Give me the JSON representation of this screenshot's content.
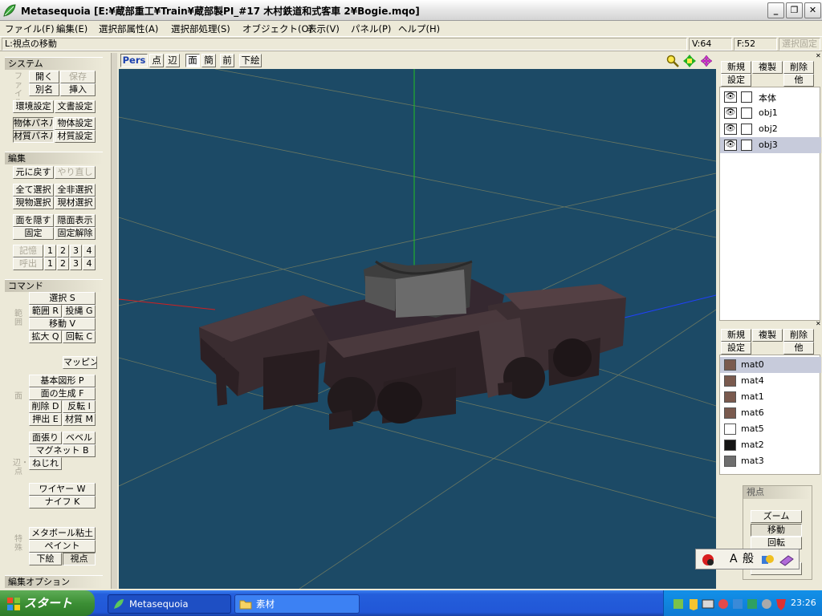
{
  "window": {
    "title": "Metasequoia [E:¥蔵部重工¥Train¥蔵部製PI_#17 木村鉄道和式客車 2¥Bogie.mqo]"
  },
  "menu": [
    "ファイル(F)",
    "編集(E)",
    "選択部属性(A)",
    "選択部処理(S)",
    "オブジェクト(O)",
    "表示(V)",
    "パネル(P)",
    "ヘルプ(H)"
  ],
  "status": {
    "hint": "L:視点の移動",
    "vertices": "V:64",
    "faces": "F:52",
    "lock": "選択固定"
  },
  "left": {
    "system": {
      "header": "システム",
      "file_label": "ファイル",
      "open": "開く",
      "save": "保存",
      "rename": "別名",
      "insert": "挿入",
      "env": "環境設定",
      "doc": "文書設定",
      "obj_panel": "物体パネル",
      "obj_settings": "物体設定",
      "mat_panel": "材質パネル",
      "mat_settings": "材質設定"
    },
    "edit": {
      "header": "編集",
      "undo": "元に戻す",
      "redo": "やり直し",
      "select_all": "全て選択",
      "deselect": "全非選択",
      "cur_obj": "現物選択",
      "cur_mat": "現材選択",
      "hide_face": "面を隠す",
      "show_face": "隠面表示",
      "fix": "固定",
      "unfix": "固定解除",
      "memory": "記憶",
      "recall": "呼出",
      "slots": [
        "1",
        "2",
        "3",
        "4"
      ]
    },
    "command": {
      "header": "コマンド",
      "range_label": "範囲",
      "select": "選択 S",
      "range": "範囲 R",
      "lasso": "投縄 G",
      "move": "移動 V",
      "scale": "拡大 Q",
      "rotate": "回転 C",
      "mapping": "マッピング",
      "face_label": "面",
      "primitive": "基本図形 P",
      "create_face": "面の生成 F",
      "delete": "削除 D",
      "flip": "反転 I",
      "extrude": "押出 E",
      "material": "材質 M",
      "edge_label": "辺・点",
      "face_fill": "面張り",
      "bevel": "ベベル",
      "magnet": "マグネット B",
      "twist": "ねじれ",
      "wire": "ワイヤー W",
      "knife": "ナイフ K",
      "special_label": "特殊",
      "metaball": "メタボール粘土",
      "paint": "ペイント",
      "underlay": "下絵",
      "view": "視点"
    },
    "edit_options": "編集オプション"
  },
  "view_toolbar": [
    "Pers",
    "点",
    "辺",
    "面",
    "簡",
    "前",
    "下絵"
  ],
  "objects_panel": {
    "new": "新規",
    "copy": "複製",
    "delete": "削除",
    "settings": "設定",
    "other": "他",
    "items": [
      "本体",
      "obj1",
      "obj2",
      "obj3"
    ],
    "selected_index": 3
  },
  "materials_panel": {
    "new": "新規",
    "copy": "複製",
    "delete": "削除",
    "settings": "設定",
    "other": "他",
    "items": [
      {
        "name": "mat0",
        "color": "#7a5a4e"
      },
      {
        "name": "mat4",
        "color": "#7a5a4e"
      },
      {
        "name": "mat1",
        "color": "#7a5a4e"
      },
      {
        "name": "mat6",
        "color": "#7a5a4e"
      },
      {
        "name": "mat5",
        "color": "#ffffff"
      },
      {
        "name": "mat2",
        "color": "#151515"
      },
      {
        "name": "mat3",
        "color": "#6e6e6e"
      }
    ],
    "selected_index": 0
  },
  "view_panel": {
    "header": "視点",
    "zoom": "ズーム",
    "move": "移動",
    "rotate": "回転",
    "extra": "ー"
  },
  "ime_toolbar": {
    "mode": "A",
    "kanji": "般"
  },
  "taskbar": {
    "start": "スタート",
    "tasks": [
      "Metasequoia",
      "素材"
    ],
    "clock": "23:26"
  }
}
